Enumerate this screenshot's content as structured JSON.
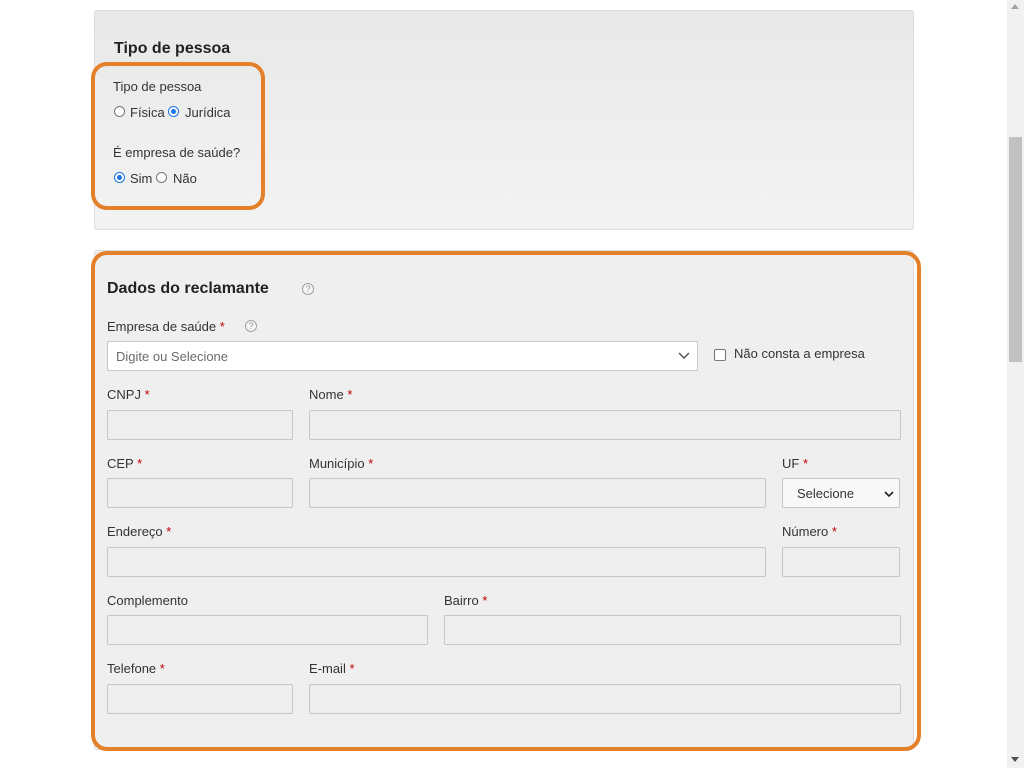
{
  "tipo_section": {
    "title": "Tipo de pessoa",
    "tipo_label": "Tipo de pessoa",
    "tipo_options": [
      "Física",
      "Jurídica"
    ],
    "tipo_selected": "Jurídica",
    "saude_label": "É empresa de saúde?",
    "saude_options": [
      "Sim",
      "Não"
    ],
    "saude_selected": "Sim"
  },
  "reclamante": {
    "title": "Dados do reclamante",
    "help_icon": "?",
    "empresa_label": "Empresa de saúde",
    "empresa_placeholder": "Digite ou Selecione",
    "nao_consta_label": "Não consta a empresa",
    "cnpj_label": "CNPJ",
    "nome_label": "Nome",
    "cep_label": "CEP",
    "municipio_label": "Município",
    "uf_label": "UF",
    "uf_selected": "Selecione",
    "endereco_label": "Endereço",
    "numero_label": "Número",
    "complemento_label": "Complemento",
    "bairro_label": "Bairro",
    "telefone_label": "Telefone",
    "email_label": "E-mail",
    "required_mark": "*"
  },
  "colors": {
    "highlight": "#e4802a",
    "radio_checked": "#1a73e8",
    "required": "#c00000"
  }
}
